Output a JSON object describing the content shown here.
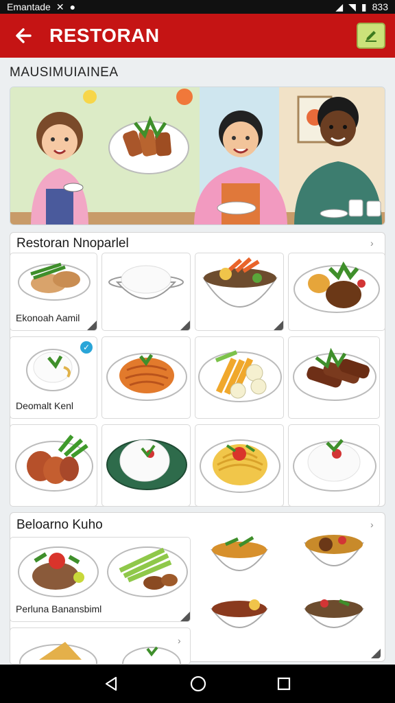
{
  "status": {
    "carrier": "Emantade",
    "time": "833"
  },
  "app_bar": {
    "title": "RESTORAN",
    "back_icon": "arrow-left-icon",
    "action_icon": "edit-icon",
    "color": "#c51414"
  },
  "section": {
    "title": "MAUSIMUIAINEA"
  },
  "categories": [
    {
      "title": "Restoran Nnoparlel",
      "tile_labels": [
        "Ekonoah Aamil",
        "Deomalt Kenl"
      ]
    },
    {
      "title": "Beloarno Kuho",
      "tile_labels": [
        "Perluna Banansbiml"
      ]
    }
  ],
  "nav": {
    "icons": [
      "back-triangle-icon",
      "home-circle-icon",
      "recents-square-icon"
    ]
  }
}
